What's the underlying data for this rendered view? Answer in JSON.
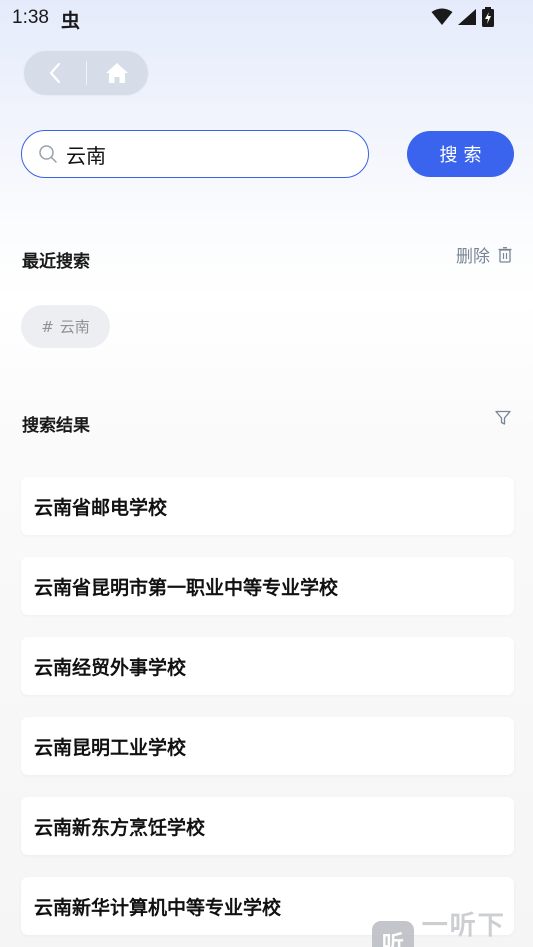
{
  "status_bar": {
    "time": "1:38",
    "notification_glyph": "虫",
    "icons": [
      "wifi-icon",
      "signal-icon",
      "battery-charging-icon"
    ]
  },
  "nav": {
    "back_icon": "chevron-left-icon",
    "home_icon": "home-icon"
  },
  "search": {
    "value": "云南",
    "button_label": "搜索"
  },
  "recent": {
    "title": "最近搜索",
    "delete_label": "删除",
    "tags": [
      {
        "hash": "#",
        "label": "云南"
      }
    ]
  },
  "results": {
    "title": "搜索结果",
    "items": [
      "云南省邮电学校",
      "云南省昆明市第一职业中等专业学校",
      "云南经贸外事学校",
      "云南昆明工业学校",
      "云南新东方烹饪学校",
      "云南新华计算机中等专业学校"
    ]
  },
  "watermark": {
    "logo": "听",
    "text": "一听下载"
  },
  "colors": {
    "accent": "#3a63ee",
    "search_border": "#3a62e6",
    "muted_text": "#7b8494"
  }
}
